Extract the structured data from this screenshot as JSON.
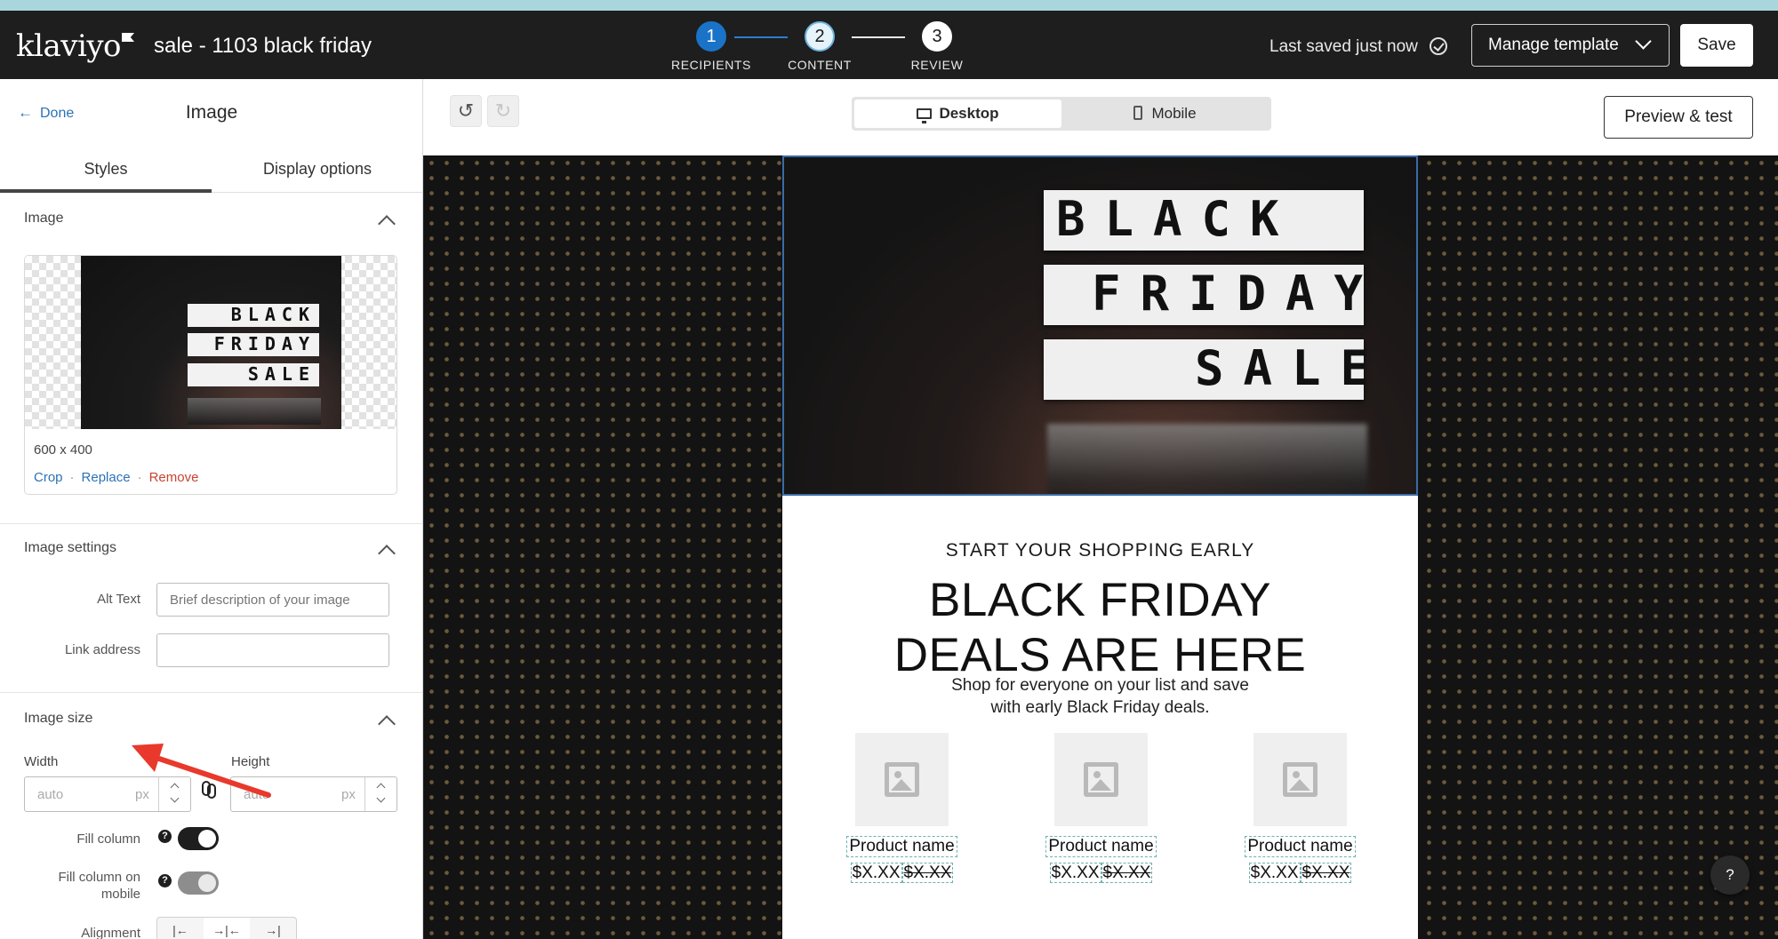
{
  "header": {
    "logo": "klaviyo",
    "campaign_title": "sale - 1103 black friday",
    "steps": [
      {
        "number": "1",
        "label": "RECIPIENTS"
      },
      {
        "number": "2",
        "label": "CONTENT"
      },
      {
        "number": "3",
        "label": "REVIEW"
      }
    ],
    "saved_status": "Last saved just now",
    "manage_label": "Manage template",
    "save_label": "Save"
  },
  "panel": {
    "done_label": "Done",
    "title": "Image",
    "tabs": [
      "Styles",
      "Display options"
    ],
    "image_section": {
      "heading": "Image",
      "thumbnail_lines": [
        "BLACK",
        "FRIDAY",
        "SALE"
      ],
      "dimensions": "600 x 400",
      "actions": [
        "Crop",
        "Replace",
        "Remove"
      ]
    },
    "settings_section": {
      "heading": "Image settings",
      "alt_label": "Alt Text",
      "alt_placeholder": "Brief description of your image",
      "link_label": "Link address",
      "link_value": ""
    },
    "size_section": {
      "heading": "Image size",
      "width_label": "Width",
      "height_label": "Height",
      "width_placeholder": "auto",
      "height_placeholder": "auto",
      "unit": "px",
      "fill_column_label": "Fill column",
      "fill_column_mobile_label": "Fill column on mobile",
      "alignment_label": "Alignment",
      "help_glyph": "?"
    }
  },
  "editor": {
    "undo_icon": "undo-icon",
    "redo_icon": "redo-icon",
    "device_options": [
      "Desktop",
      "Mobile"
    ],
    "preview_label": "Preview & test",
    "help_fab": "?"
  },
  "email": {
    "hero_lines": [
      "BLACK",
      "FRIDAY",
      "SALE"
    ],
    "pre_heading": "START YOUR SHOPPING EARLY",
    "headline_lines": [
      "BLACK FRIDAY",
      "DEALS ARE HERE"
    ],
    "body_lines": [
      "Shop for everyone on your list and save",
      "with early Black Friday deals."
    ],
    "products": [
      {
        "name": "Product name",
        "price": "$X.XX",
        "old_price": "$X.XX"
      },
      {
        "name": "Product name",
        "price": "$X.XX",
        "old_price": "$X.XX"
      },
      {
        "name": "Product name",
        "price": "$X.XX",
        "old_price": "$X.XX"
      }
    ]
  },
  "colors": {
    "accent_blue": "#1a73c7",
    "link_blue": "#2b72b8",
    "remove_red": "#c9442f",
    "annotation_red": "#e8392c",
    "toggle_on": "#1e1e1e",
    "toggle_off": "#8d8d8d"
  }
}
